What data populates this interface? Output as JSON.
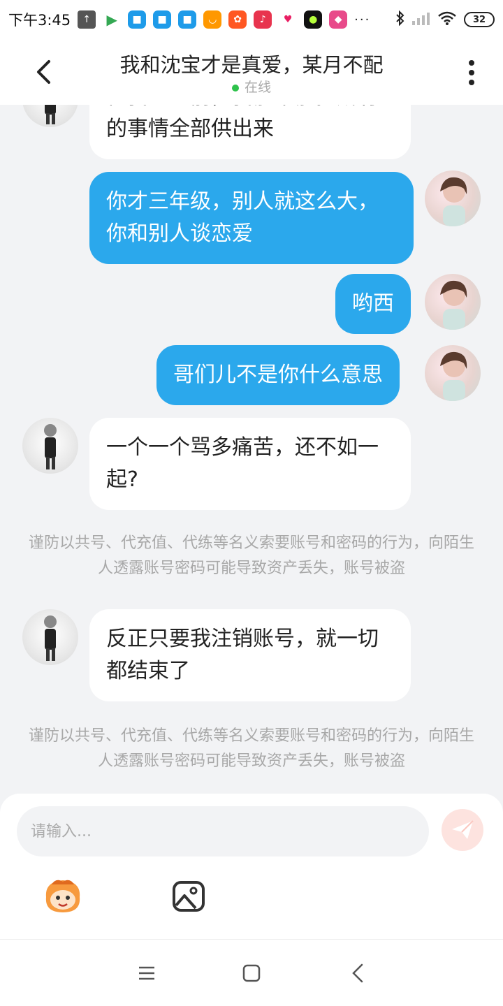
{
  "status_bar": {
    "time": "下午3:45",
    "battery": "32",
    "more": "···"
  },
  "header": {
    "title": "我和沈宝才是真爱，某月不配",
    "status": "在线"
  },
  "messages": [
    {
      "side": "in",
      "text": "的事情全部供出来",
      "partial_line": "在我死之前，我能不能把所有"
    },
    {
      "side": "out",
      "text": "你才三年级，别人就这么大，你和别人谈恋爱"
    },
    {
      "side": "out",
      "text": "哟西"
    },
    {
      "side": "out",
      "text": "哥们儿不是你什么意思"
    },
    {
      "side": "in",
      "text": "一个一个骂多痛苦，还不如一起?"
    },
    {
      "side": "in",
      "text": "反正只要我注销账号，就一切都结束了"
    }
  ],
  "notices": [
    "谨防以共号、代充值、代练等名义索要账号和密码的行为，向陌生人透露账号密码可能导致资产丢失，账号被盗",
    "谨防以共号、代充值、代练等名义索要账号和密码的行为，向陌生人透露账号密码可能导致资产丢失，账号被盗"
  ],
  "input": {
    "placeholder": "请输入...",
    "value": ""
  },
  "colors": {
    "outgoing_bubble": "#2ba8ec",
    "incoming_bubble": "#ffffff",
    "online_dot": "#2ec24b",
    "send_button": "#fde3df"
  },
  "icons": {
    "back": "chevron-left-icon",
    "menu": "more-vertical-icon",
    "send": "paper-plane-icon",
    "emoji": "mascot-emoji-icon",
    "image": "image-icon"
  }
}
